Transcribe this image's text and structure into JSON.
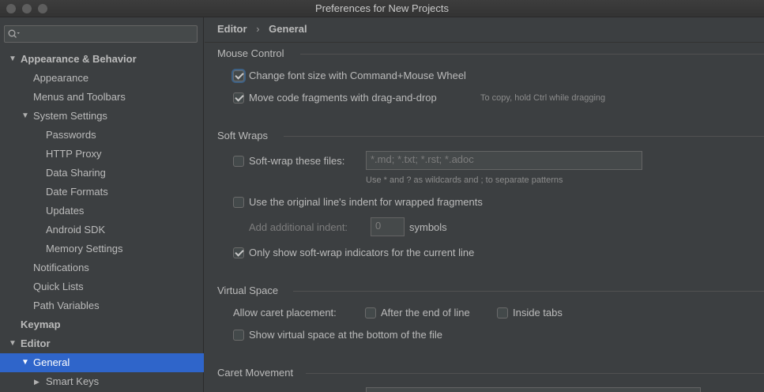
{
  "window": {
    "title": "Preferences for New Projects"
  },
  "sidebar": {
    "search_placeholder": "",
    "items": [
      {
        "label": "Appearance & Behavior",
        "arrow": "▼"
      },
      {
        "label": "Appearance"
      },
      {
        "label": "Menus and Toolbars"
      },
      {
        "label": "System Settings",
        "arrow": "▼"
      },
      {
        "label": "Passwords"
      },
      {
        "label": "HTTP Proxy"
      },
      {
        "label": "Data Sharing"
      },
      {
        "label": "Date Formats"
      },
      {
        "label": "Updates"
      },
      {
        "label": "Android SDK"
      },
      {
        "label": "Memory Settings"
      },
      {
        "label": "Notifications"
      },
      {
        "label": "Quick Lists"
      },
      {
        "label": "Path Variables"
      },
      {
        "label": "Keymap"
      },
      {
        "label": "Editor",
        "arrow": "▼"
      },
      {
        "label": "General",
        "arrow": "▼",
        "selected": true
      },
      {
        "label": "Smart Keys",
        "arrow": "▶"
      }
    ]
  },
  "breadcrumb": {
    "parent": "Editor",
    "separator": "›",
    "current": "General"
  },
  "mouse_control": {
    "title": "Mouse Control",
    "font_size_label": "Change font size with Command+Mouse Wheel",
    "font_size_checked": true,
    "drag_drop_label": "Move code fragments with drag-and-drop",
    "drag_drop_checked": true,
    "drag_drop_hint": "To copy, hold Ctrl while dragging"
  },
  "soft_wraps": {
    "title": "Soft Wraps",
    "files_label": "Soft-wrap these files:",
    "files_checked": false,
    "files_placeholder": "*.md; *.txt; *.rst; *.adoc",
    "files_hint": "Use * and ? as wildcards and ; to separate patterns",
    "indent_label": "Use the original line's indent for wrapped fragments",
    "indent_checked": false,
    "additional_indent_label": "Add additional indent:",
    "additional_indent_value": "0",
    "symbols_label": "symbols",
    "indicators_label": "Only show soft-wrap indicators for the current line",
    "indicators_checked": true
  },
  "virtual_space": {
    "title": "Virtual Space",
    "caret_label": "Allow caret placement:",
    "after_end_label": "After the end of line",
    "after_end_checked": false,
    "inside_tabs_label": "Inside tabs",
    "inside_tabs_checked": false,
    "bottom_label": "Show virtual space at the bottom of the file",
    "bottom_checked": false
  },
  "caret_movement": {
    "title": "Caret Movement"
  },
  "colors": {
    "accent": "#2f65ca",
    "background": "#3c3f41",
    "text": "#bbbbbb"
  }
}
